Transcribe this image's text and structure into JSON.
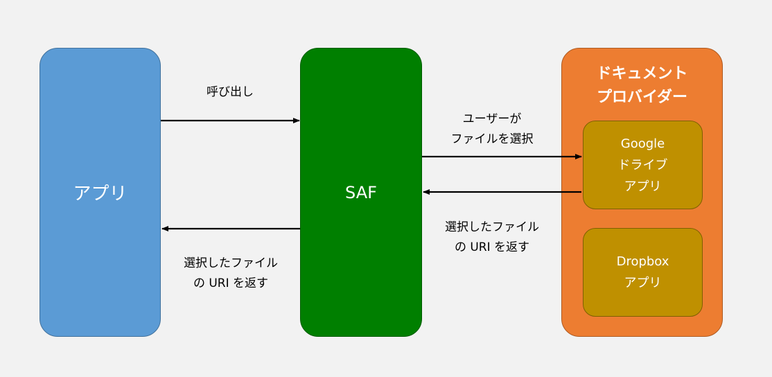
{
  "nodes": {
    "app": "アプリ",
    "saf": "SAF",
    "provider": {
      "line1": "ドキュメント",
      "line2": "プロバイダー"
    },
    "google": {
      "line1": "Google",
      "line2": "ドライブ",
      "line3": "アプリ"
    },
    "dropbox": {
      "line1": "Dropbox",
      "line2": "アプリ"
    }
  },
  "edges": {
    "call": "呼び出し",
    "user_select": {
      "line1": "ユーザーが",
      "line2": "ファイルを選択"
    },
    "return_right": {
      "line1": "選択したファイル",
      "line2": "の URI を返す"
    },
    "return_left": {
      "line1": "選択したファイル",
      "line2": "の URI を返す"
    }
  },
  "colors": {
    "app": "#5b9bd5",
    "saf": "#007f00",
    "provider": "#ed7d31",
    "provider_app": "#bf9000",
    "background": "#f2f2f2"
  }
}
